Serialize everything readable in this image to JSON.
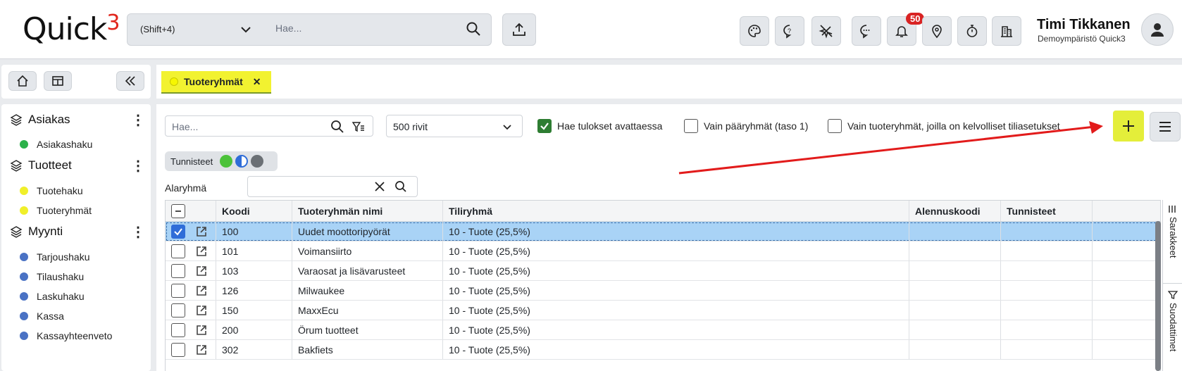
{
  "header": {
    "logo_text": "Quick",
    "logo_sup": "3",
    "shortcut": "(Shift+4)",
    "search_placeholder": "Hae...",
    "notification_count": "50",
    "user_name": "Timi Tikkanen",
    "user_env": "Demoympäristö Quick3"
  },
  "sidebar": {
    "sections": [
      {
        "title": "Asiakas",
        "items": [
          {
            "label": "Asiakashaku",
            "color": "#2bb14a"
          }
        ]
      },
      {
        "title": "Tuotteet",
        "items": [
          {
            "label": "Tuotehaku",
            "color": "#f0ef2a"
          },
          {
            "label": "Tuoteryhmät",
            "color": "#f0ef2a"
          }
        ]
      },
      {
        "title": "Myynti",
        "items": [
          {
            "label": "Tarjoushaku",
            "color": "#4a72c4"
          },
          {
            "label": "Tilaushaku",
            "color": "#4a72c4"
          },
          {
            "label": "Laskuhaku",
            "color": "#4a72c4"
          },
          {
            "label": "Kassa",
            "color": "#4a72c4"
          },
          {
            "label": "Kassayhteenveto",
            "color": "#4a72c4"
          }
        ]
      }
    ]
  },
  "tab": {
    "label": "Tuoteryhmät",
    "close": "✕"
  },
  "filters": {
    "search_placeholder": "Hae...",
    "rows_value": "500 rivit",
    "cb_search_on_open": "Hae tulokset avattaessa",
    "cb_main_groups": "Vain pääryhmät (taso 1)",
    "cb_valid_accounts": "Vain tuoteryhmät, joilla on kelvolliset tiliasetukset",
    "tags_label": "Tunnisteet",
    "subgroup_label": "Alaryhmä"
  },
  "grid": {
    "columns": [
      "Koodi",
      "Tuoteryhmän nimi",
      "Tiliryhmä",
      "Alennuskoodi",
      "Tunnisteet"
    ],
    "rows": [
      {
        "code": "100",
        "name": "Uudet moottoripyörät",
        "account": "10 - Tuote (25,5%)",
        "selected": true
      },
      {
        "code": "101",
        "name": "Voimansiirto",
        "account": "10 - Tuote (25,5%)"
      },
      {
        "code": "103",
        "name": "Varaosat ja lisävarusteet",
        "account": "10 - Tuote (25,5%)"
      },
      {
        "code": "126",
        "name": "Milwaukee",
        "account": "10 - Tuote (25,5%)"
      },
      {
        "code": "150",
        "name": "MaxxEcu",
        "account": "10 - Tuote (25,5%)"
      },
      {
        "code": "200",
        "name": "Örum tuotteet",
        "account": "10 - Tuote (25,5%)"
      },
      {
        "code": "302",
        "name": "Bakfiets",
        "account": "10 - Tuote (25,5%)"
      }
    ],
    "side_columns": "Sarakkeet",
    "side_filters": "Suodattimet"
  }
}
